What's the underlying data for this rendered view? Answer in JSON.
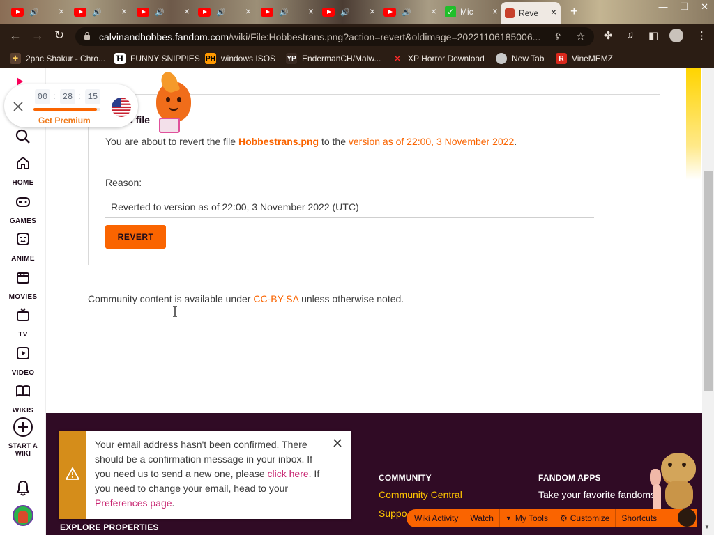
{
  "browser": {
    "tabs": [
      {
        "title": "",
        "type": "youtube"
      },
      {
        "title": "",
        "type": "youtube"
      },
      {
        "title": "",
        "type": "youtube"
      },
      {
        "title": "",
        "type": "youtube"
      },
      {
        "title": "",
        "type": "youtube"
      },
      {
        "title": "",
        "type": "youtube"
      },
      {
        "title": "",
        "type": "youtube"
      },
      {
        "title": "Mic",
        "type": "check"
      },
      {
        "title": "Reve",
        "type": "fandom",
        "active": true
      }
    ],
    "url_host": "calvinandhobbes.fandom.com",
    "url_path": "/wiki/File:Hobbestrans.png?action=revert&oldimage=20221106185006...",
    "bookmarks": [
      {
        "label": "2pac Shakur - Chro...",
        "icon": "puzzle-icon"
      },
      {
        "label": "FUNNY SNIPPIES",
        "icon": "H"
      },
      {
        "label": "windows ISOS",
        "icon": "PH"
      },
      {
        "label": "EndermanCH/Malw...",
        "icon": "YP"
      },
      {
        "label": "XP Horror Download",
        "icon": "X"
      },
      {
        "label": "New Tab",
        "icon": "globe-icon"
      },
      {
        "label": "VineMEMZ",
        "icon": "R"
      }
    ]
  },
  "hola": {
    "timer": [
      "00",
      "28",
      "15"
    ],
    "progress": 0.95,
    "premium_label": "Get Premium"
  },
  "sidebar": {
    "items": [
      {
        "label": "HOME"
      },
      {
        "label": "GAMES"
      },
      {
        "label": "ANIME"
      },
      {
        "label": "MOVIES"
      },
      {
        "label": "TV"
      },
      {
        "label": "VIDEO"
      },
      {
        "label": "WIKIS"
      },
      {
        "label": "START A WIKI"
      }
    ]
  },
  "main": {
    "card_title_fragment": "c file",
    "msg_prefix": "You are about to revert the file ",
    "file_name": "Hobbestrans.png",
    "msg_middle": " to the ",
    "version_link": "version as of 22:00, 3 November 2022",
    "msg_suffix": ".",
    "reason_label": "Reason:",
    "reason_value": "Reverted to version as of 22:00, 3 November 2022 (UTC)",
    "revert_button": "REVERT",
    "license_prefix": "Community content is available under ",
    "license_link": "CC-BY-SA",
    "license_suffix": " unless otherwise noted."
  },
  "notification": {
    "text1": "Your email address hasn't been confirmed. There should be a confirmation message in your inbox. If you need us to send a new one, please ",
    "link1": "click here",
    "text2": ". If you need to change your email, head to your ",
    "link2": "Preferences page",
    "text3": "."
  },
  "footer": {
    "explore_heading": "EXPLORE PROPERTIES",
    "community_heading": "COMMUNITY",
    "community_central": "Community Central",
    "support_fragment": "Suppo",
    "apps_heading": "FANDOM APPS",
    "apps_text": "Take your favorite fandoms"
  },
  "wiki_toolbar": {
    "items": [
      "Wiki Activity",
      "Watch",
      "My Tools",
      "Customize",
      "Shortcuts"
    ]
  },
  "colors": {
    "fandom_orange": "#fa6400",
    "footer_bg": "#300b25",
    "link_pink": "#c7226f",
    "warning_bar": "#d58d1a"
  }
}
